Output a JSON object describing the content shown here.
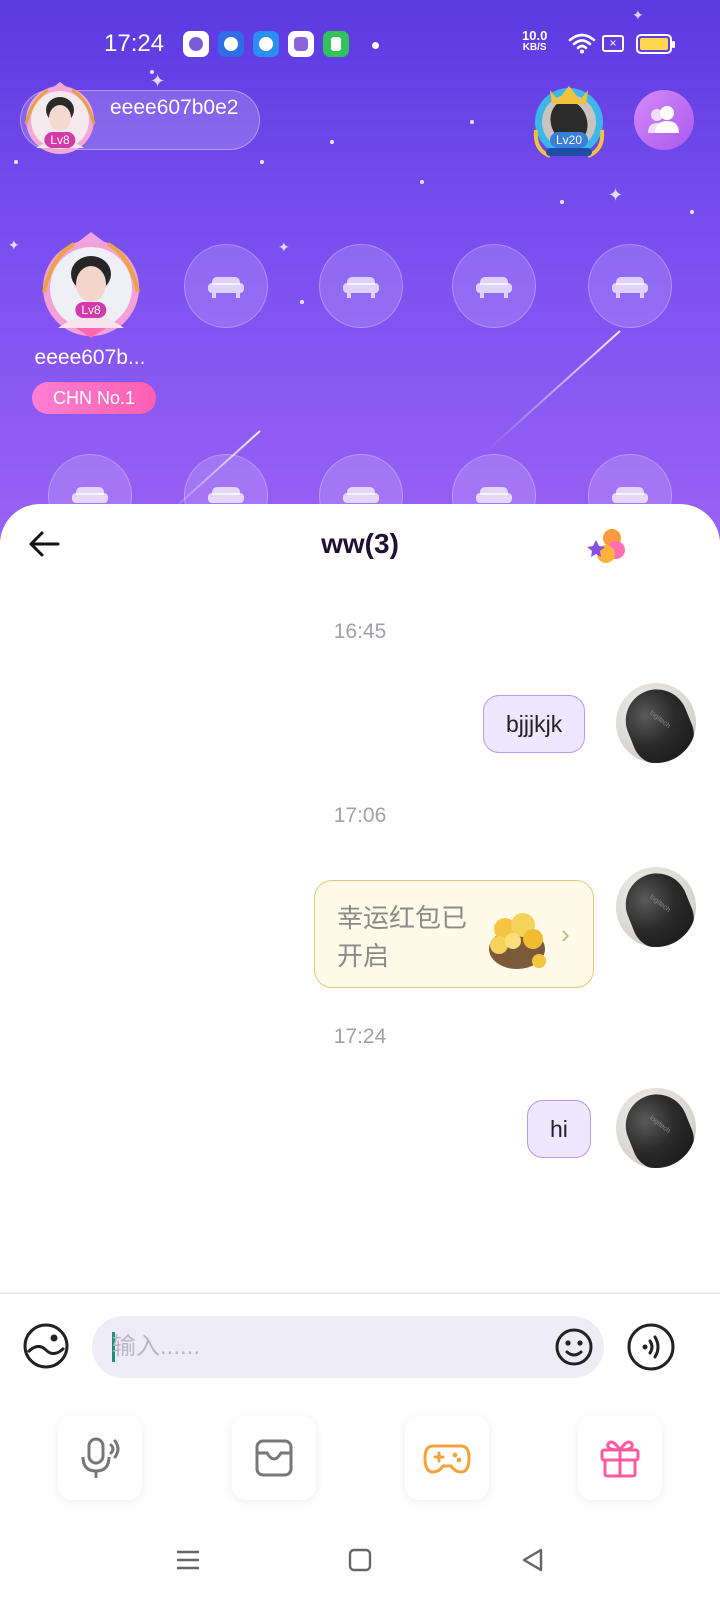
{
  "status_bar": {
    "time": "17:24",
    "net_speed_value": "10.0",
    "net_speed_unit": "KB/S",
    "battery_color": "#ffd84d",
    "notification_icons": [
      "photo-app-icon",
      "baidu-app-icon",
      "blue-dot-app-icon",
      "purple-app-icon",
      "green-bag-app-icon"
    ]
  },
  "room": {
    "background_start": "#5b3ae0",
    "background_end": "#9a62f5",
    "host": {
      "name": "eeee607b0e2",
      "level": "Lv8"
    },
    "top_right_badge_level": "Lv20",
    "main_seat": {
      "name": "eeee607b...",
      "level": "Lv8",
      "tag": "CHN No.1"
    },
    "empty_seat_icon": "sofa-icon"
  },
  "chat": {
    "title": "ww(3)",
    "accent_color": "#b99ae8",
    "messages": [
      {
        "time": "16:45",
        "type": "text",
        "text": "bjjjkjk"
      },
      {
        "time": "17:06",
        "type": "red_packet",
        "text": "幸运红包已开启"
      },
      {
        "time": "17:24",
        "type": "text",
        "text": "hi"
      }
    ]
  },
  "input": {
    "placeholder": "输入......",
    "value": ""
  },
  "toolbar": {
    "items": [
      "mic-icon",
      "album-icon",
      "game-icon",
      "gift-icon"
    ]
  },
  "navbar": {
    "items": [
      "menu-icon",
      "home-icon",
      "back-icon"
    ]
  }
}
